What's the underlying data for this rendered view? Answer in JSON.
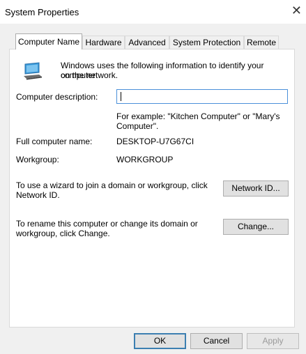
{
  "window": {
    "title": "System Properties",
    "close_glyph": "✕"
  },
  "tabs": [
    {
      "label": "Computer Name"
    },
    {
      "label": "Hardware"
    },
    {
      "label": "Advanced"
    },
    {
      "label": "System Protection"
    },
    {
      "label": "Remote"
    }
  ],
  "computer_name": {
    "intro_line1": "Windows uses the following information to identify your computer",
    "intro_line2": "on the network.",
    "description_label": "Computer description:",
    "description_value": "",
    "example_line1": "For example: \"Kitchen Computer\" or \"Mary's",
    "example_line2": "Computer\".",
    "full_name_label": "Full computer name:",
    "full_name_value": "DESKTOP-U7G67CI",
    "workgroup_label": "Workgroup:",
    "workgroup_value": "WORKGROUP",
    "wizard_line1": "To use a wizard to join a domain or workgroup, click",
    "wizard_line2": "Network ID.",
    "network_id_button": "Network ID...",
    "rename_line1": "To rename this computer or change its domain or",
    "rename_line2": "workgroup, click Change.",
    "change_button": "Change..."
  },
  "footer": {
    "ok": "OK",
    "cancel": "Cancel",
    "apply": "Apply"
  },
  "icons": {
    "computer": "computer-icon",
    "close": "close-icon"
  }
}
